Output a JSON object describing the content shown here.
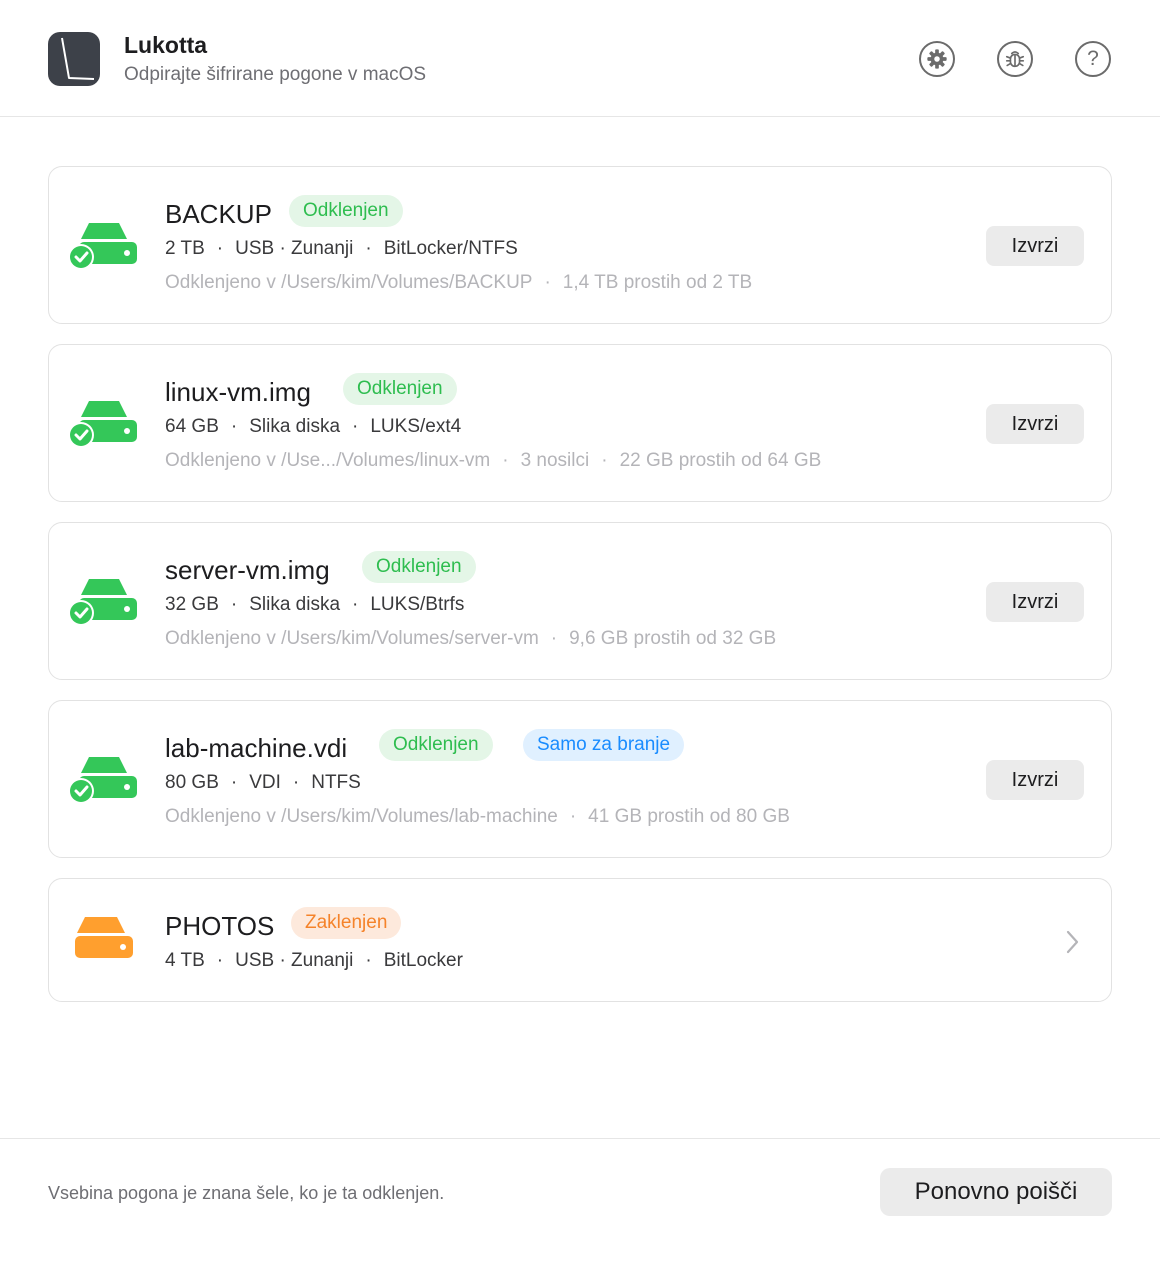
{
  "app": {
    "title": "Lukotta",
    "subtitle": "Odpirajte šifrirane pogone v macOS",
    "icon": "app-logo",
    "header_buttons": [
      "gear-icon",
      "bug-icon",
      "help-icon"
    ],
    "help_glyph": "?"
  },
  "colors": {
    "unlocked": "#34c759",
    "locked": "#ff9f2e",
    "readonly": "#1a8cff"
  },
  "drives": [
    {
      "name": "BACKUP",
      "status": "Odklenjen",
      "extra_badge": "",
      "size": "2 TB",
      "type": "USB · Zunanji",
      "format": "BitLocker/NTFS",
      "mount": "Odklenjeno v /Users/kim/Volumes/BACKUP",
      "volumes": "",
      "free": "1,4 TB prostih od 2 TB",
      "action": "Izvrzi",
      "icon": "drive-unlocked-icon"
    },
    {
      "name": "linux-vm.img",
      "status": "Odklenjen",
      "extra_badge": "",
      "size": "64 GB",
      "type": "Slika diska",
      "format": "LUKS/ext4",
      "mount": "Odklenjeno v /Use.../Volumes/linux-vm",
      "volumes": "3 nosilci",
      "free": "22 GB prostih od 64 GB",
      "action": "Izvrzi",
      "icon": "drive-unlocked-icon"
    },
    {
      "name": "server-vm.img",
      "status": "Odklenjen",
      "extra_badge": "",
      "size": "32 GB",
      "type": "Slika diska",
      "format": "LUKS/Btrfs",
      "mount": "Odklenjeno v /Users/kim/Volumes/server-vm",
      "volumes": "",
      "free": "9,6 GB prostih od 32 GB",
      "action": "Izvrzi",
      "icon": "drive-unlocked-icon"
    },
    {
      "name": "lab-machine.vdi",
      "status": "Odklenjen",
      "extra_badge": "Samo za branje",
      "size": "80 GB",
      "type": "VDI",
      "format": "NTFS",
      "mount": "Odklenjeno v /Users/kim/Volumes/lab-machine",
      "volumes": "",
      "free": "41 GB prostih od 80 GB",
      "action": "Izvrzi",
      "icon": "drive-unlocked-icon"
    },
    {
      "name": "PHOTOS",
      "status": "Zaklenjen",
      "extra_badge": "",
      "size": "4 TB",
      "type": "USB · Zunanji",
      "format": "BitLocker",
      "mount": "",
      "volumes": "",
      "free": "",
      "action": "",
      "icon": "drive-locked-icon"
    }
  ],
  "footer": {
    "note": "Vsebina pogona je znana šele, ko je ta odklenjen.",
    "rescan_label": "Ponovno poišči"
  }
}
